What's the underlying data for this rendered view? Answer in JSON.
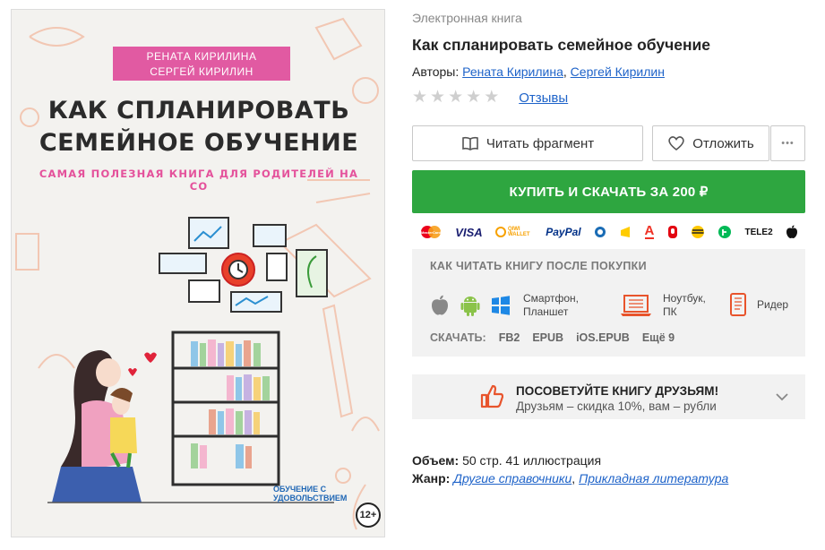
{
  "cover": {
    "authors": [
      "РЕНАТА КИРИЛИНА",
      "СЕРГЕЙ КИРИЛИН"
    ],
    "title_lines": [
      "КАК СПЛАНИРОВАТЬ",
      "СЕМЕЙНОЕ ОБУЧЕНИЕ"
    ],
    "subtitle": "САМАЯ ПОЛЕЗНАЯ КНИГА ДЛЯ РОДИТЕЛЕЙ НА СО",
    "publisher": "ОБУЧЕНИЕ С УДОВОЛЬСТВИЕМ",
    "age_rating": "12+"
  },
  "product": {
    "type_label": "Электронная книга",
    "title": "Как спланировать семейное обучение",
    "authors_label": "Авторы:",
    "authors": [
      "Рената Кирилина",
      "Сергей Кирилин"
    ],
    "rating_stars": 0,
    "rating_max": 5,
    "reviews_label": "Отзывы"
  },
  "actions": {
    "read_fragment": "Читать фрагмент",
    "defer": "Отложить",
    "more": "•••",
    "buy": "КУПИТЬ И СКАЧАТЬ ЗА 200 ₽"
  },
  "payments": [
    {
      "name": "mastercard-icon",
      "label": "MasterCard"
    },
    {
      "name": "visa-icon",
      "label": "VISA"
    },
    {
      "name": "qiwi-icon",
      "label": "QIWI WALLET"
    },
    {
      "name": "paypal-icon",
      "label": "PayPal"
    },
    {
      "name": "webmoney-icon",
      "label": ""
    },
    {
      "name": "yandex-money-icon",
      "label": ""
    },
    {
      "name": "alfa-bank-icon",
      "label": "А"
    },
    {
      "name": "mts-icon",
      "label": ""
    },
    {
      "name": "beeline-icon",
      "label": ""
    },
    {
      "name": "megafon-icon",
      "label": ""
    },
    {
      "name": "tele2-icon",
      "label": "TELE2"
    },
    {
      "name": "apple-icon",
      "label": ""
    }
  ],
  "howto": {
    "title": "КАК ЧИТАТЬ КНИГУ ПОСЛЕ ПОКУПКИ",
    "phone_label_1": "Смартфон,",
    "phone_label_2": "Планшет",
    "laptop_label_1": "Ноутбук,",
    "laptop_label_2": "ПК",
    "reader_label": "Ридер",
    "download_label": "СКАЧАТЬ:",
    "formats": [
      "FB2",
      "EPUB",
      "iOS.EPUB",
      "Ещё 9"
    ]
  },
  "recommend": {
    "title": "ПОСОВЕТУЙТЕ КНИГУ ДРУЗЬЯМ!",
    "subtitle": "Друзьям – скидка 10%, вам – рубли"
  },
  "meta": {
    "volume_label": "Объем:",
    "volume_value": "50 стр. 41 иллюстрация",
    "genre_label": "Жанр:",
    "genres": [
      "Другие справочники",
      "Прикладная литература"
    ]
  },
  "colors": {
    "buy": "#2ea640",
    "link": "#1e63c9",
    "cover_pink": "#e15aa2",
    "thumb_orange": "#e8542c"
  }
}
